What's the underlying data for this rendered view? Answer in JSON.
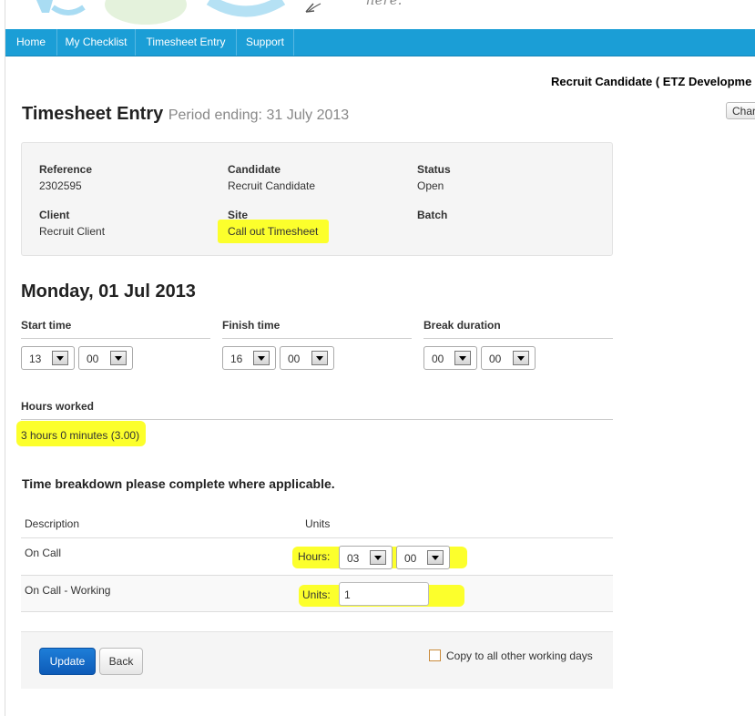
{
  "banner": {
    "handwriting": "here."
  },
  "nav": {
    "items": [
      "Home",
      "My Checklist",
      "Timesheet Entry",
      "Support"
    ]
  },
  "user": {
    "name": "Recruit Candidate ( ETZ Developme",
    "change_label": "Char"
  },
  "page": {
    "title": "Timesheet Entry",
    "subtitle": "Period ending: 31 July 2013"
  },
  "info": {
    "reference_label": "Reference",
    "reference": "2302595",
    "candidate_label": "Candidate",
    "candidate": "Recruit Candidate",
    "status_label": "Status",
    "status": "Open",
    "client_label": "Client",
    "client": "Recruit Client",
    "site_label": "Site",
    "site": "Call out Timesheet",
    "batch_label": "Batch"
  },
  "day": {
    "title": "Monday, 01 Jul 2013",
    "start_label": "Start time",
    "start_hour": "13",
    "start_min": "00",
    "finish_label": "Finish time",
    "finish_hour": "16",
    "finish_min": "00",
    "break_label": "Break duration",
    "break_hour": "00",
    "break_min": "00",
    "hours_label": "Hours worked",
    "hours_value": "3 hours 0 minutes (3.00)"
  },
  "breakdown": {
    "title": "Time breakdown please complete where applicable.",
    "col_description": "Description",
    "col_units": "Units",
    "rows": [
      {
        "description": "On Call",
        "label": "Hours:",
        "hour": "03",
        "min": "00"
      },
      {
        "description": "On Call - Working",
        "label": "Units:",
        "value": "1"
      }
    ]
  },
  "actions": {
    "update": "Update",
    "back": "Back",
    "copy_label": "Copy to all other working days"
  },
  "colors": {
    "nav": "#1b9ed6",
    "highlight": "#fcff2c",
    "primary": "#0d5bb8"
  }
}
